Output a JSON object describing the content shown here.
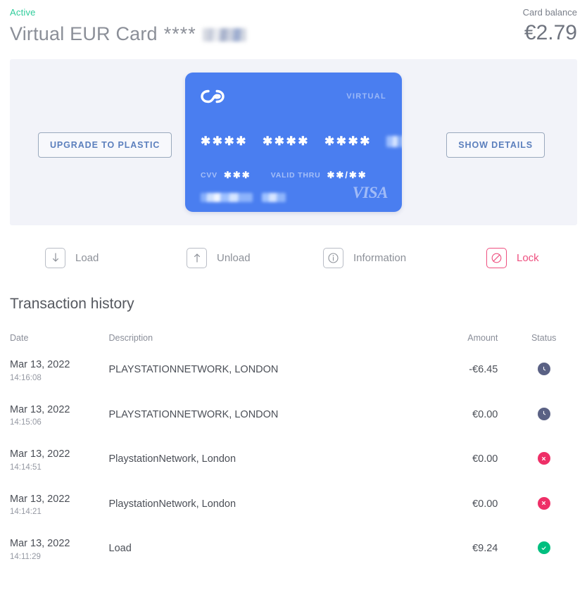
{
  "header": {
    "status": "Active",
    "title": "Virtual EUR Card",
    "mask": "****",
    "balance_label": "Card balance",
    "balance_value": "€2.79",
    "status_color": "#2fcc9b"
  },
  "card_panel": {
    "upgrade_button": "UPGRADE TO PLASTIC",
    "details_button": "SHOW DETAILS",
    "card": {
      "type_label": "VIRTUAL",
      "number_groups": [
        "✱✱✱✱",
        "✱✱✱✱",
        "✱✱✱✱"
      ],
      "cvv_label": "CVV",
      "cvv_value": "✱✱✱",
      "valid_label": "VALID THRU",
      "valid_value": "✱✱/✱✱",
      "network": "VISA",
      "background_color": "#4a7ef0"
    }
  },
  "actions": [
    {
      "label": "Load",
      "icon": "arrow-down-icon"
    },
    {
      "label": "Unload",
      "icon": "arrow-up-icon"
    },
    {
      "label": "Information",
      "icon": "info-icon"
    },
    {
      "label": "Lock",
      "icon": "block-icon",
      "color": "#ee4f7f"
    }
  ],
  "transactions": {
    "title": "Transaction history",
    "columns": [
      "Date",
      "Description",
      "Amount",
      "Status"
    ],
    "rows": [
      {
        "date": "Mar 13, 2022",
        "time": "14:16:08",
        "description": "PLAYSTATIONNETWORK, LONDON",
        "amount": "-€6.45",
        "status": "pending"
      },
      {
        "date": "Mar 13, 2022",
        "time": "14:15:06",
        "description": "PLAYSTATIONNETWORK, LONDON",
        "amount": "€0.00",
        "status": "pending"
      },
      {
        "date": "Mar 13, 2022",
        "time": "14:14:51",
        "description": "PlaystationNetwork, London",
        "amount": "€0.00",
        "status": "failed"
      },
      {
        "date": "Mar 13, 2022",
        "time": "14:14:21",
        "description": "PlaystationNetwork, London",
        "amount": "€0.00",
        "status": "failed"
      },
      {
        "date": "Mar 13, 2022",
        "time": "14:11:29",
        "description": "Load",
        "amount": "€9.24",
        "status": "completed"
      }
    ]
  }
}
